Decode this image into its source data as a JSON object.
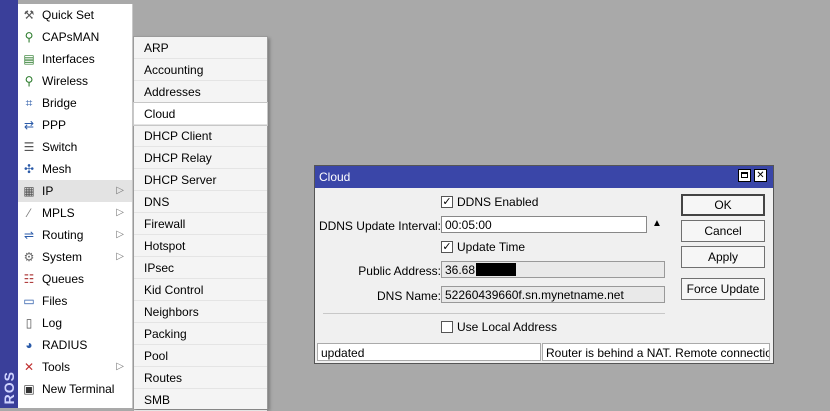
{
  "brand": {
    "text": "ROS"
  },
  "main_menu": {
    "items": [
      {
        "label": "Quick Set",
        "icon": "quick-set-icon",
        "submenu": false
      },
      {
        "label": "CAPsMAN",
        "icon": "capsman-icon",
        "submenu": false
      },
      {
        "label": "Interfaces",
        "icon": "interfaces-icon",
        "submenu": false
      },
      {
        "label": "Wireless",
        "icon": "wireless-icon",
        "submenu": false
      },
      {
        "label": "Bridge",
        "icon": "bridge-icon",
        "submenu": false
      },
      {
        "label": "PPP",
        "icon": "ppp-icon",
        "submenu": false
      },
      {
        "label": "Switch",
        "icon": "switch-icon",
        "submenu": false
      },
      {
        "label": "Mesh",
        "icon": "mesh-icon",
        "submenu": false
      },
      {
        "label": "IP",
        "icon": "ip-icon",
        "submenu": true
      },
      {
        "label": "MPLS",
        "icon": "mpls-icon",
        "submenu": true
      },
      {
        "label": "Routing",
        "icon": "routing-icon",
        "submenu": true
      },
      {
        "label": "System",
        "icon": "system-icon",
        "submenu": true
      },
      {
        "label": "Queues",
        "icon": "queues-icon",
        "submenu": false
      },
      {
        "label": "Files",
        "icon": "files-icon",
        "submenu": false
      },
      {
        "label": "Log",
        "icon": "log-icon",
        "submenu": false
      },
      {
        "label": "RADIUS",
        "icon": "radius-icon",
        "submenu": false
      },
      {
        "label": "Tools",
        "icon": "tools-icon",
        "submenu": true
      },
      {
        "label": "New Terminal",
        "icon": "terminal-icon",
        "submenu": false
      }
    ],
    "arrow_glyph": "▷"
  },
  "submenu": {
    "items": [
      "ARP",
      "Accounting",
      "Addresses",
      "Cloud",
      "DHCP Client",
      "DHCP Relay",
      "DHCP Server",
      "DNS",
      "Firewall",
      "Hotspot",
      "IPsec",
      "Kid Control",
      "Neighbors",
      "Packing",
      "Pool",
      "Routes",
      "SMB"
    ]
  },
  "dialog": {
    "title": "Cloud",
    "ddns_enabled_label": "DDNS Enabled",
    "ddns_enabled_checked": true,
    "ddns_interval_label": "DDNS Update Interval:",
    "ddns_interval_value": "00:05:00",
    "update_time_label": "Update Time",
    "update_time_checked": true,
    "public_address_label": "Public Address:",
    "public_address_value": "36.68.",
    "dns_name_label": "DNS Name:",
    "dns_name_value": "52260439660f.sn.mynetname.net",
    "use_local_label": "Use Local Address",
    "use_local_checked": false,
    "buttons": {
      "ok": "OK",
      "cancel": "Cancel",
      "apply": "Apply",
      "force_update": "Force Update"
    },
    "status_left": "updated",
    "status_right": "Router is behind a NAT. Remote connection ..."
  },
  "colors": {
    "titlebar": "#3a46a8",
    "brand_strip": "#3a3f9a",
    "desktop": "#a9a9a9"
  }
}
